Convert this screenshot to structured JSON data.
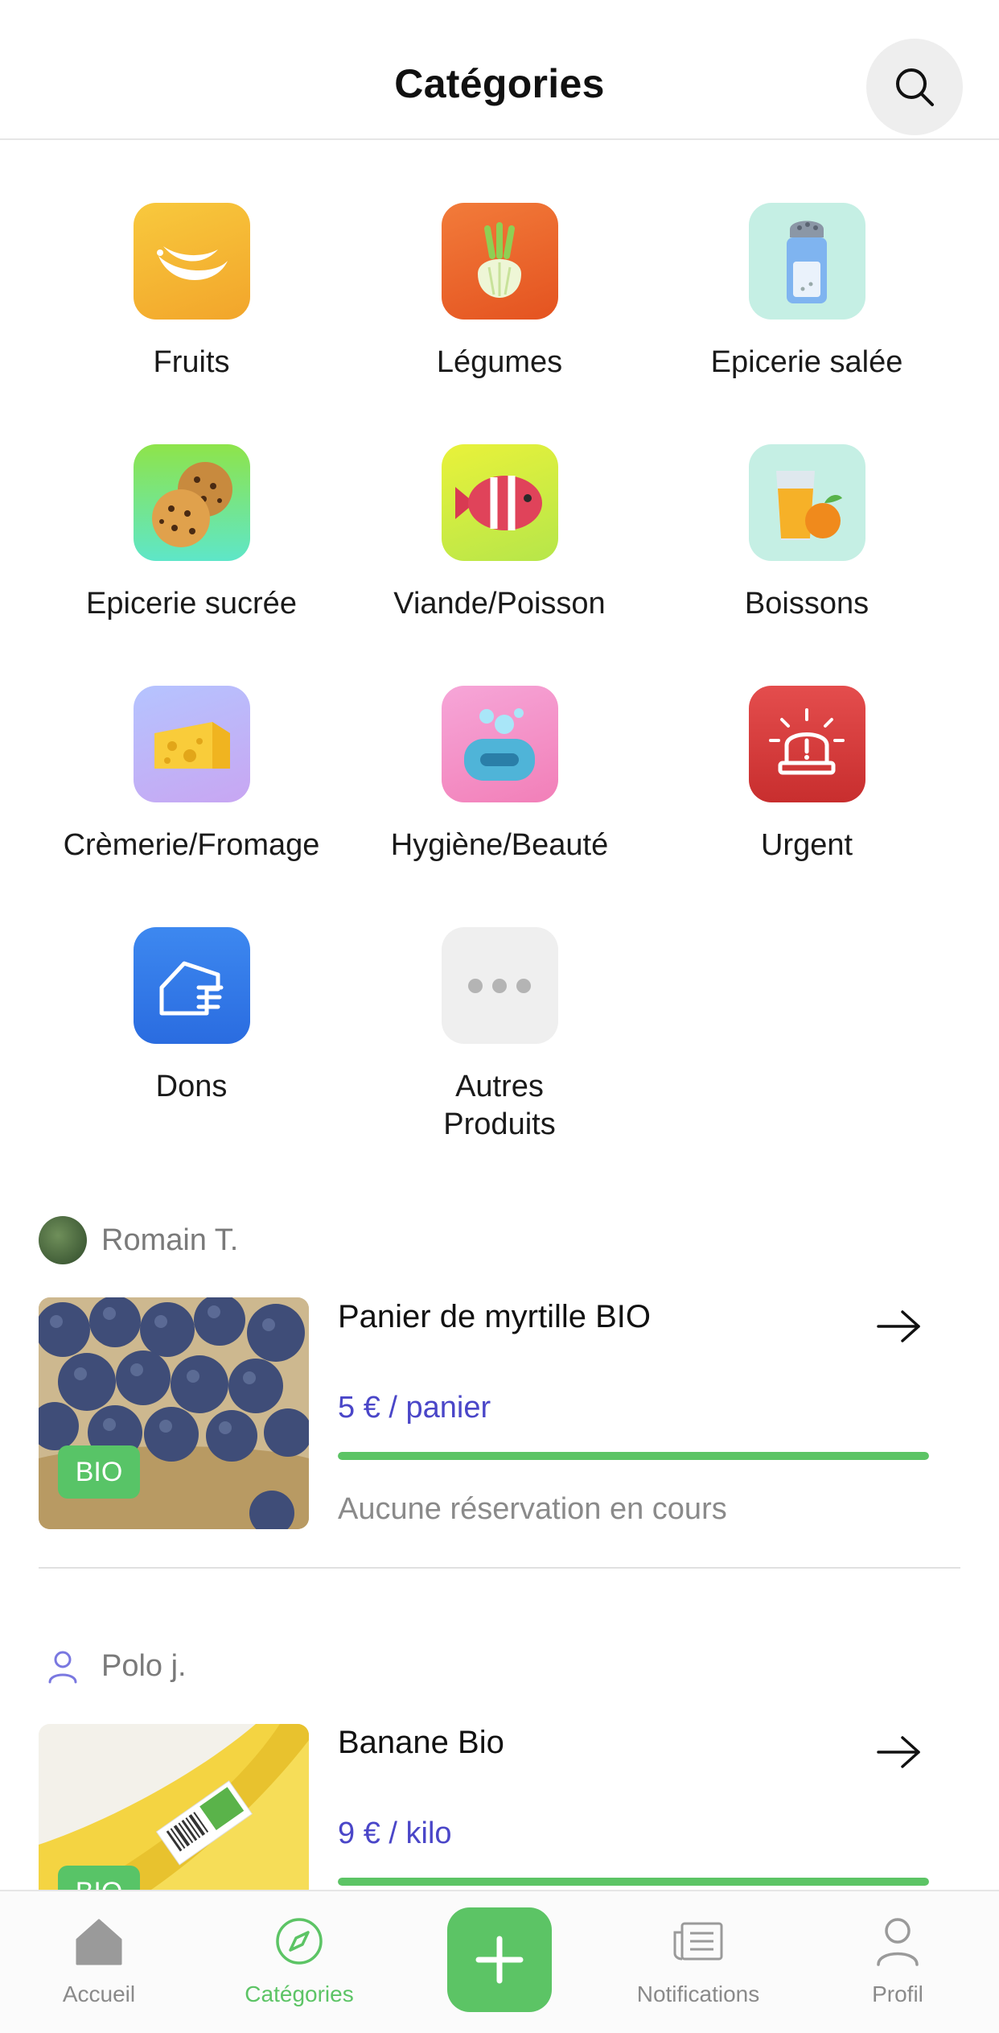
{
  "header": {
    "title": "Catégories",
    "search_icon": "search-icon"
  },
  "categories": [
    {
      "label": "Fruits",
      "icon": "banana-icon"
    },
    {
      "label": "Légumes",
      "icon": "fennel-icon"
    },
    {
      "label": "Epicerie salée",
      "icon": "salt-shaker-icon"
    },
    {
      "label": "Epicerie sucrée",
      "icon": "cookies-icon"
    },
    {
      "label": "Viande/Poisson",
      "icon": "fish-icon"
    },
    {
      "label": "Boissons",
      "icon": "juice-icon"
    },
    {
      "label": "Crèmerie/Fromage",
      "icon": "cheese-icon"
    },
    {
      "label": "Hygiène/Beauté",
      "icon": "soap-icon"
    },
    {
      "label": "Urgent",
      "icon": "siren-icon"
    },
    {
      "label": "Dons",
      "icon": "donation-hand-icon"
    },
    {
      "label": "Autres\nProduits",
      "icon": "more-icon"
    }
  ],
  "listings": [
    {
      "seller": "Romain T.",
      "title": "Panier de myrtille BIO",
      "price": "5 € / panier",
      "badge": "BIO",
      "progress": 1.0,
      "status": "Aucune réservation en cours"
    },
    {
      "seller": "Polo j.",
      "title": "Banane Bio",
      "price": "9 € / kilo",
      "badge": "BIO",
      "progress": 1.0
    }
  ],
  "tabbar": {
    "tabs": [
      {
        "label": "Accueil",
        "icon": "home-icon"
      },
      {
        "label": "Catégories",
        "icon": "compass-icon",
        "active": true
      },
      {
        "label": "Notifications",
        "icon": "newspaper-icon"
      },
      {
        "label": "Profil",
        "icon": "user-icon"
      }
    ],
    "fab_icon": "plus-icon"
  },
  "colors": {
    "accent_green": "#5cc465",
    "price_purple": "#4a46c8",
    "muted_gray": "#8a8a8a"
  }
}
